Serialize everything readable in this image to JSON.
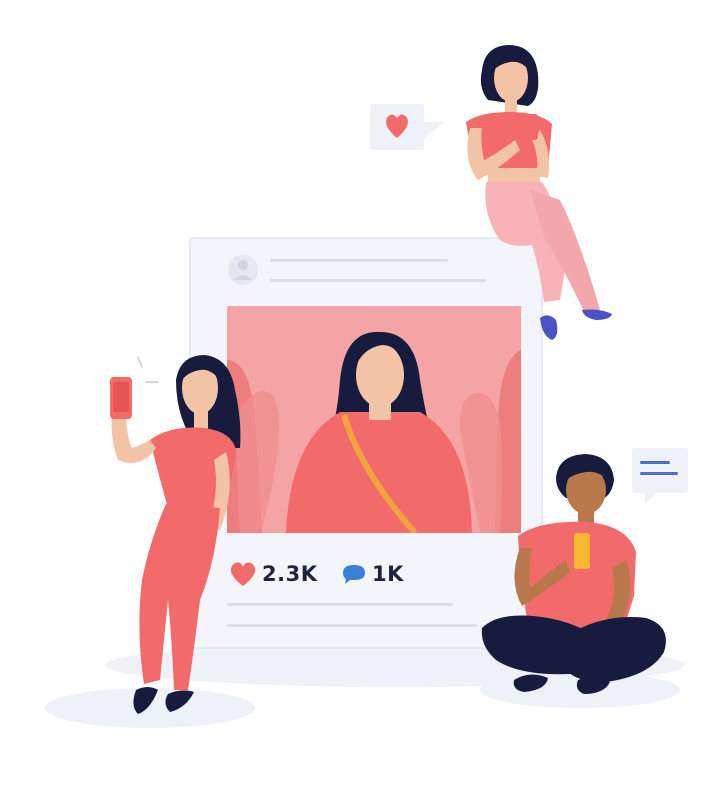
{
  "post": {
    "likes_count": "2.3K",
    "comments_count": "1K"
  },
  "icons": {
    "like": "heart-icon",
    "comment": "speech-bubble-icon",
    "avatar": "user-avatar-icon"
  },
  "colors": {
    "coral": "#f26a6a",
    "navy": "#171b3d",
    "card": "#f3f5fa",
    "photo_bg": "#f4a4a4",
    "skin_light": "#f2c3a4",
    "skin_dark": "#b9774c",
    "accent_blue": "#4a6fd1"
  }
}
